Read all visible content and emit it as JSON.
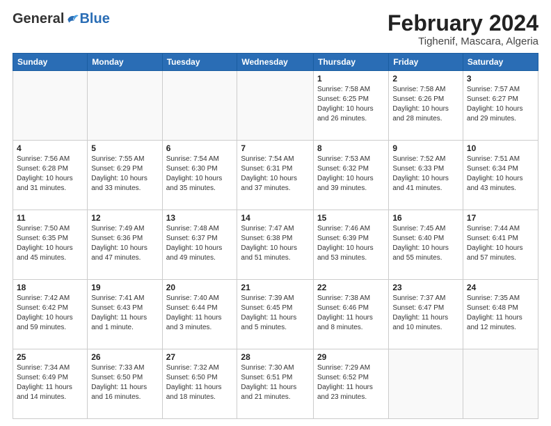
{
  "header": {
    "logo_general": "General",
    "logo_blue": "Blue",
    "month_title": "February 2024",
    "location": "Tighenif, Mascara, Algeria"
  },
  "weekdays": [
    "Sunday",
    "Monday",
    "Tuesday",
    "Wednesday",
    "Thursday",
    "Friday",
    "Saturday"
  ],
  "weeks": [
    [
      {
        "day": "",
        "detail": ""
      },
      {
        "day": "",
        "detail": ""
      },
      {
        "day": "",
        "detail": ""
      },
      {
        "day": "",
        "detail": ""
      },
      {
        "day": "1",
        "detail": "Sunrise: 7:58 AM\nSunset: 6:25 PM\nDaylight: 10 hours\nand 26 minutes."
      },
      {
        "day": "2",
        "detail": "Sunrise: 7:58 AM\nSunset: 6:26 PM\nDaylight: 10 hours\nand 28 minutes."
      },
      {
        "day": "3",
        "detail": "Sunrise: 7:57 AM\nSunset: 6:27 PM\nDaylight: 10 hours\nand 29 minutes."
      }
    ],
    [
      {
        "day": "4",
        "detail": "Sunrise: 7:56 AM\nSunset: 6:28 PM\nDaylight: 10 hours\nand 31 minutes."
      },
      {
        "day": "5",
        "detail": "Sunrise: 7:55 AM\nSunset: 6:29 PM\nDaylight: 10 hours\nand 33 minutes."
      },
      {
        "day": "6",
        "detail": "Sunrise: 7:54 AM\nSunset: 6:30 PM\nDaylight: 10 hours\nand 35 minutes."
      },
      {
        "day": "7",
        "detail": "Sunrise: 7:54 AM\nSunset: 6:31 PM\nDaylight: 10 hours\nand 37 minutes."
      },
      {
        "day": "8",
        "detail": "Sunrise: 7:53 AM\nSunset: 6:32 PM\nDaylight: 10 hours\nand 39 minutes."
      },
      {
        "day": "9",
        "detail": "Sunrise: 7:52 AM\nSunset: 6:33 PM\nDaylight: 10 hours\nand 41 minutes."
      },
      {
        "day": "10",
        "detail": "Sunrise: 7:51 AM\nSunset: 6:34 PM\nDaylight: 10 hours\nand 43 minutes."
      }
    ],
    [
      {
        "day": "11",
        "detail": "Sunrise: 7:50 AM\nSunset: 6:35 PM\nDaylight: 10 hours\nand 45 minutes."
      },
      {
        "day": "12",
        "detail": "Sunrise: 7:49 AM\nSunset: 6:36 PM\nDaylight: 10 hours\nand 47 minutes."
      },
      {
        "day": "13",
        "detail": "Sunrise: 7:48 AM\nSunset: 6:37 PM\nDaylight: 10 hours\nand 49 minutes."
      },
      {
        "day": "14",
        "detail": "Sunrise: 7:47 AM\nSunset: 6:38 PM\nDaylight: 10 hours\nand 51 minutes."
      },
      {
        "day": "15",
        "detail": "Sunrise: 7:46 AM\nSunset: 6:39 PM\nDaylight: 10 hours\nand 53 minutes."
      },
      {
        "day": "16",
        "detail": "Sunrise: 7:45 AM\nSunset: 6:40 PM\nDaylight: 10 hours\nand 55 minutes."
      },
      {
        "day": "17",
        "detail": "Sunrise: 7:44 AM\nSunset: 6:41 PM\nDaylight: 10 hours\nand 57 minutes."
      }
    ],
    [
      {
        "day": "18",
        "detail": "Sunrise: 7:42 AM\nSunset: 6:42 PM\nDaylight: 10 hours\nand 59 minutes."
      },
      {
        "day": "19",
        "detail": "Sunrise: 7:41 AM\nSunset: 6:43 PM\nDaylight: 11 hours\nand 1 minute."
      },
      {
        "day": "20",
        "detail": "Sunrise: 7:40 AM\nSunset: 6:44 PM\nDaylight: 11 hours\nand 3 minutes."
      },
      {
        "day": "21",
        "detail": "Sunrise: 7:39 AM\nSunset: 6:45 PM\nDaylight: 11 hours\nand 5 minutes."
      },
      {
        "day": "22",
        "detail": "Sunrise: 7:38 AM\nSunset: 6:46 PM\nDaylight: 11 hours\nand 8 minutes."
      },
      {
        "day": "23",
        "detail": "Sunrise: 7:37 AM\nSunset: 6:47 PM\nDaylight: 11 hours\nand 10 minutes."
      },
      {
        "day": "24",
        "detail": "Sunrise: 7:35 AM\nSunset: 6:48 PM\nDaylight: 11 hours\nand 12 minutes."
      }
    ],
    [
      {
        "day": "25",
        "detail": "Sunrise: 7:34 AM\nSunset: 6:49 PM\nDaylight: 11 hours\nand 14 minutes."
      },
      {
        "day": "26",
        "detail": "Sunrise: 7:33 AM\nSunset: 6:50 PM\nDaylight: 11 hours\nand 16 minutes."
      },
      {
        "day": "27",
        "detail": "Sunrise: 7:32 AM\nSunset: 6:50 PM\nDaylight: 11 hours\nand 18 minutes."
      },
      {
        "day": "28",
        "detail": "Sunrise: 7:30 AM\nSunset: 6:51 PM\nDaylight: 11 hours\nand 21 minutes."
      },
      {
        "day": "29",
        "detail": "Sunrise: 7:29 AM\nSunset: 6:52 PM\nDaylight: 11 hours\nand 23 minutes."
      },
      {
        "day": "",
        "detail": ""
      },
      {
        "day": "",
        "detail": ""
      }
    ]
  ]
}
